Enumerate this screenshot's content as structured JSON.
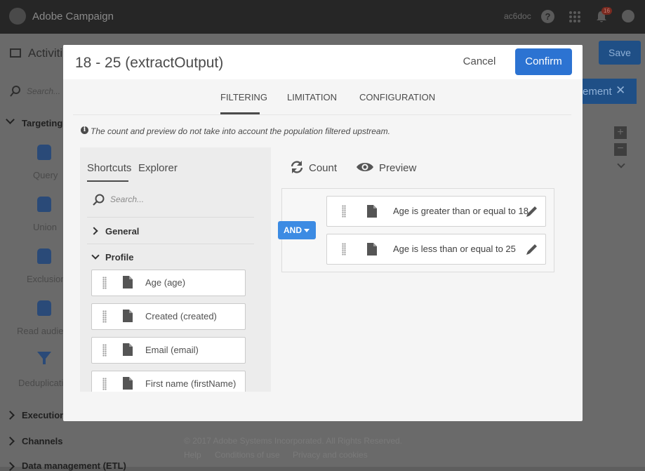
{
  "app": {
    "brand": "Adobe Campaign",
    "username": "ac6doc",
    "notification_count": "16"
  },
  "background": {
    "page_title": "Activiti",
    "save_label": "Save",
    "search_placeholder": "Search...",
    "banner_label": "ement",
    "sidebar": {
      "targeting": "Targeting",
      "items": [
        "Query",
        "Union",
        "Exclusion",
        "Read audien",
        "Deduplicati"
      ],
      "execution": "Execution",
      "channels": "Channels",
      "data_management": "Data management (ETL)"
    },
    "footer": {
      "copyright": "© 2017 Adobe Systems Incorporated. All Rights Reserved.",
      "links": [
        "Help",
        "Conditions of use",
        "Privacy and cookies"
      ]
    }
  },
  "modal": {
    "title": "18 - 25 (extractOutput)",
    "cancel_label": "Cancel",
    "confirm_label": "Confirm",
    "tabs": [
      "FILTERING",
      "LIMITATION",
      "CONFIGURATION"
    ],
    "active_tab": "FILTERING",
    "note": "The count and preview do not take into account the population filtered upstream.",
    "left": {
      "subtabs": [
        "Shortcuts",
        "Explorer"
      ],
      "search_placeholder": "Search...",
      "groups": [
        "General",
        "Profile"
      ],
      "fields": [
        "Age (age)",
        "Created (created)",
        "Email (email)",
        "First name (firstName)"
      ]
    },
    "right": {
      "count_label": "Count",
      "preview_label": "Preview",
      "operator": "AND",
      "conditions": [
        "Age is greater than or equal to 18",
        "Age is less than or equal to 25"
      ]
    }
  },
  "colors": {
    "accent": "#2c73d2",
    "and_button": "#3c8be3",
    "topbar": "#262626"
  }
}
